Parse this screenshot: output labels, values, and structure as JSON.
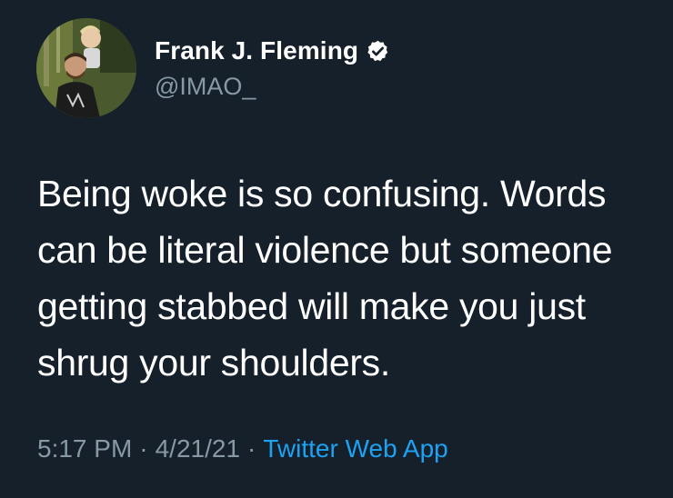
{
  "tweet": {
    "display_name": "Frank J. Fleming",
    "handle": "@IMAO_",
    "verified_icon": "verified-badge-icon",
    "lines": [
      "Being woke is so confusing. Words",
      "can be literal violence but someone",
      "getting stabbed will make you just",
      "shrug your shoulders."
    ],
    "time": "5:17 PM",
    "separator": "·",
    "date": "4/21/21",
    "source": "Twitter Web App"
  },
  "colors": {
    "background": "#15202b",
    "text": "#ffffff",
    "muted": "#8899a6",
    "link": "#1da1f2"
  }
}
